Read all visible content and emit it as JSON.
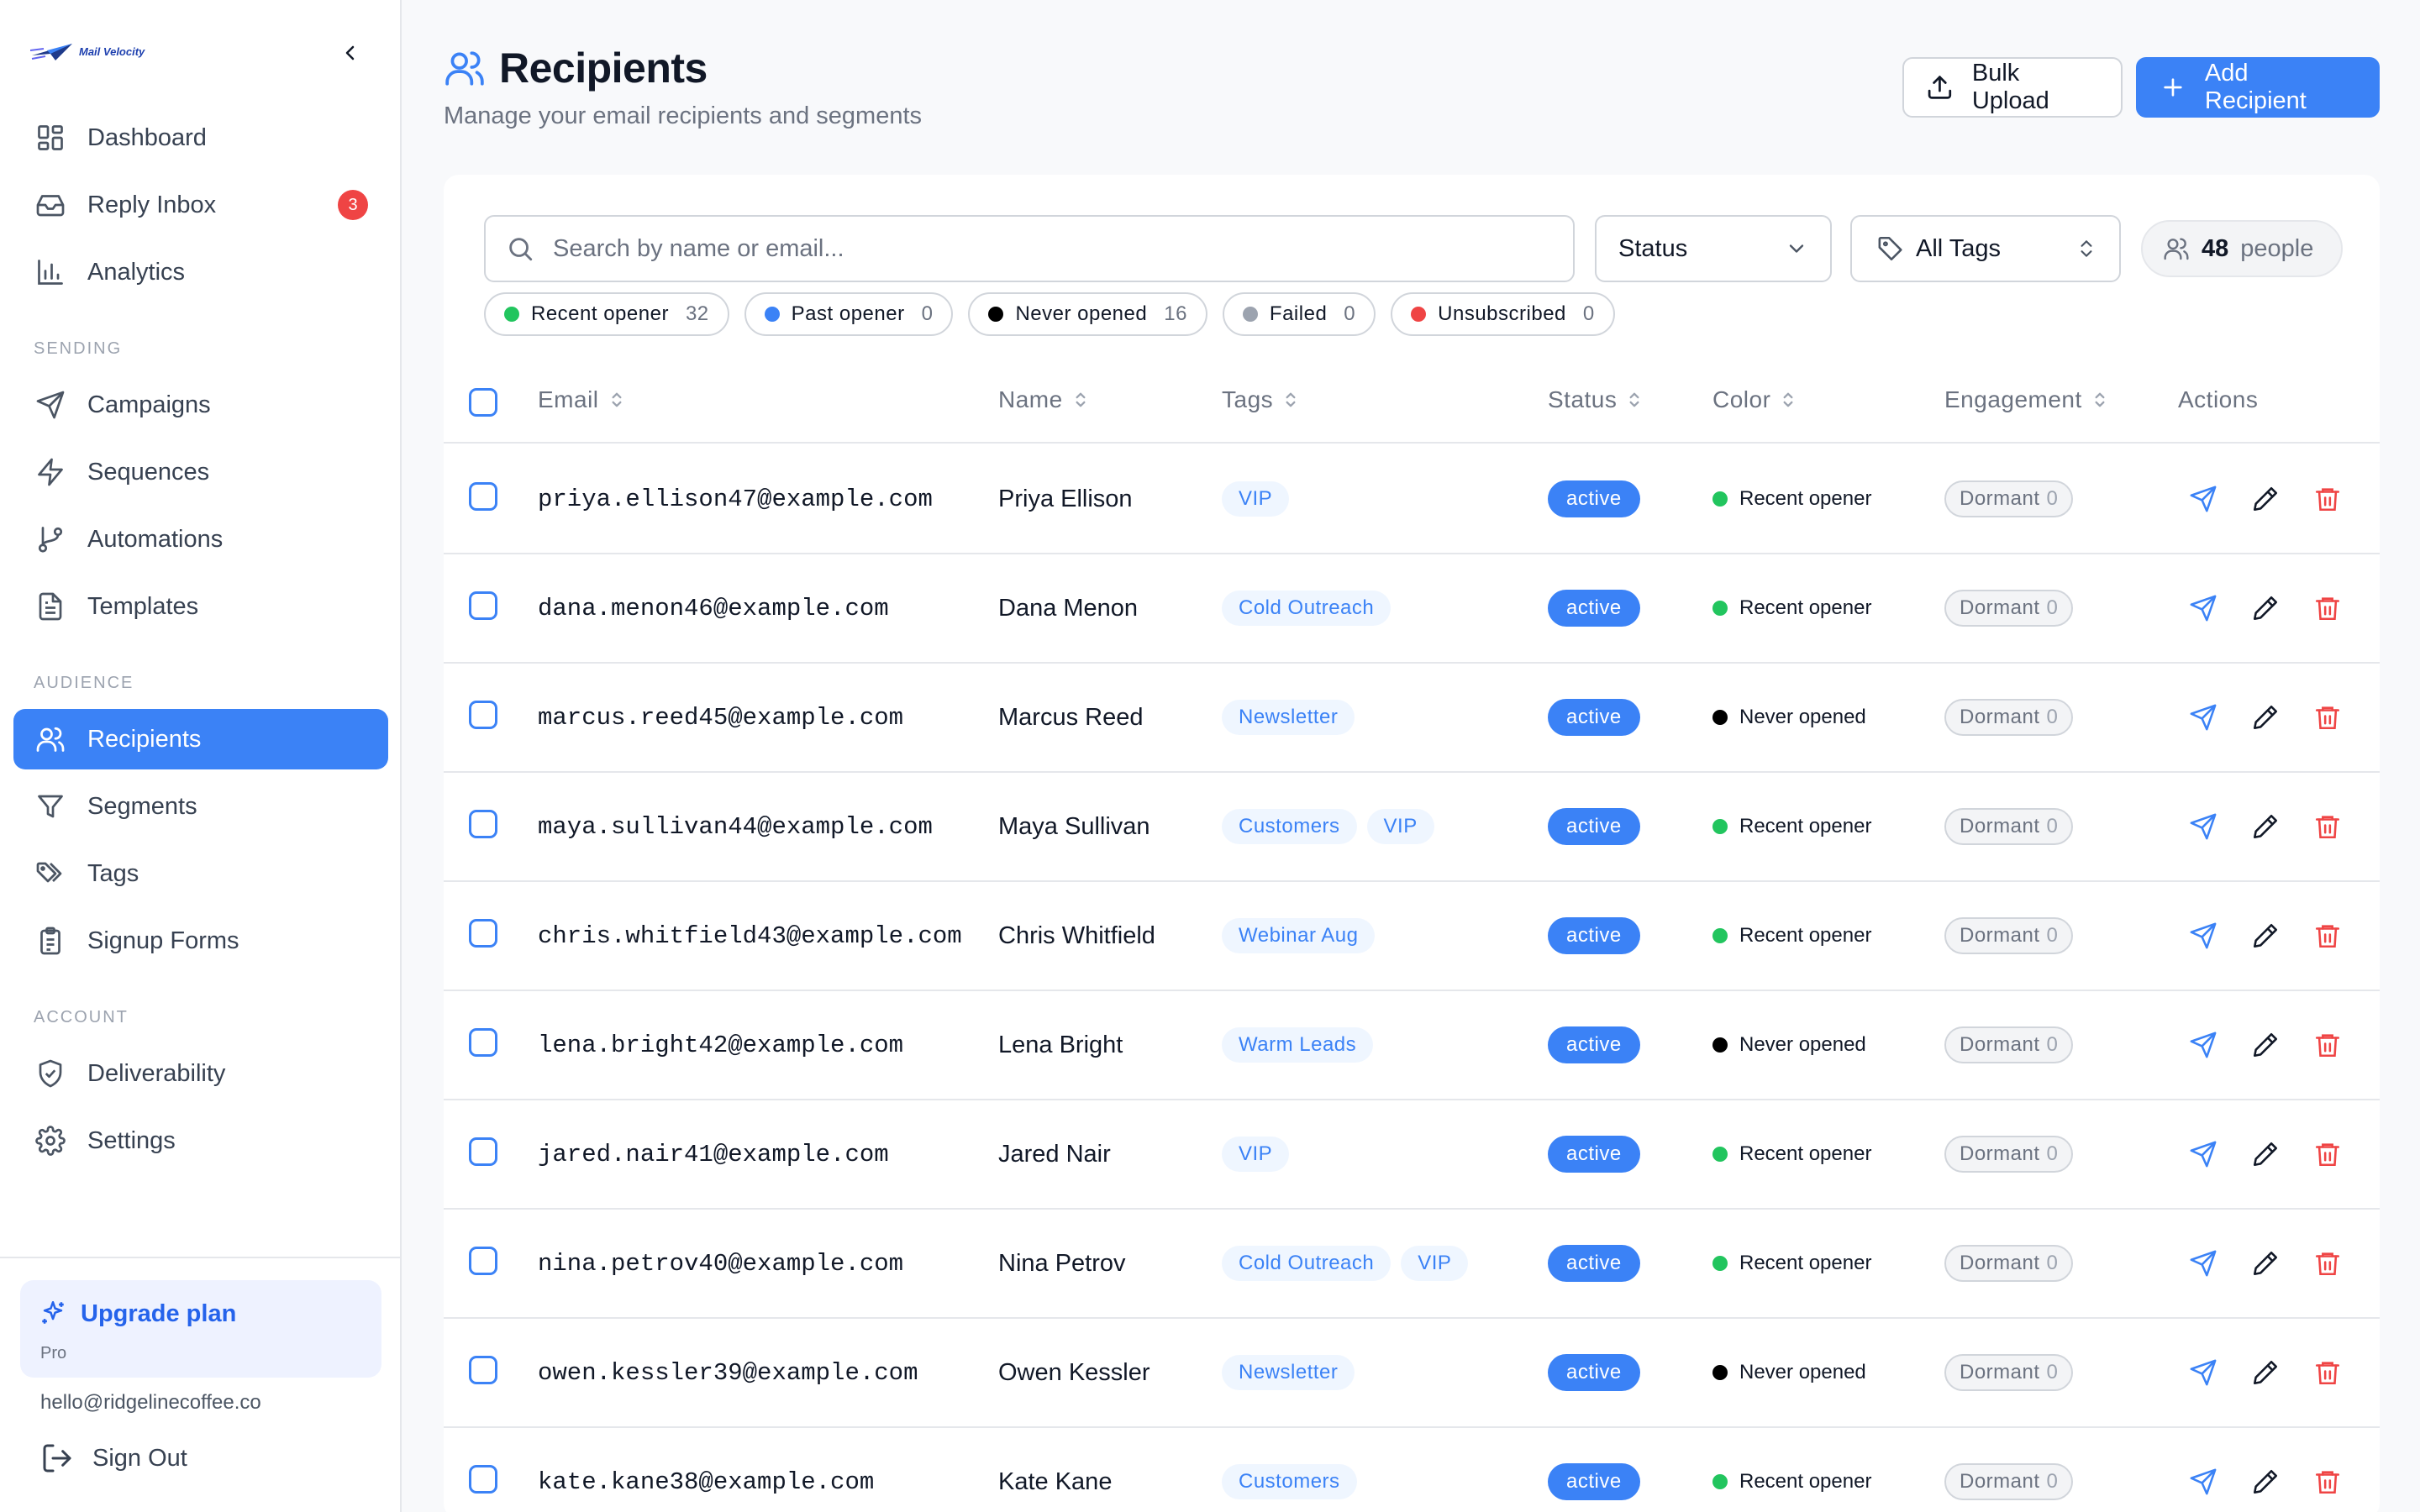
{
  "brand": {
    "name": "Mail Velocity",
    "accent": "#3b82f6"
  },
  "sidebar": {
    "nav": [
      {
        "label": "Dashboard",
        "icon": "dashboard-icon"
      },
      {
        "label": "Reply Inbox",
        "icon": "inbox-icon",
        "badge": "3"
      },
      {
        "label": "Analytics",
        "icon": "bar-chart-icon"
      }
    ],
    "sections": {
      "sending": "SENDING",
      "audience": "AUDIENCE",
      "account": "ACCOUNT"
    },
    "sending": [
      {
        "label": "Campaigns",
        "icon": "send-icon"
      },
      {
        "label": "Sequences",
        "icon": "lightning-icon"
      },
      {
        "label": "Automations",
        "icon": "git-branch-icon"
      },
      {
        "label": "Templates",
        "icon": "file-text-icon"
      }
    ],
    "audience": [
      {
        "label": "Recipients",
        "icon": "users-icon",
        "active": true
      },
      {
        "label": "Segments",
        "icon": "filter-icon"
      },
      {
        "label": "Tags",
        "icon": "tags-icon"
      },
      {
        "label": "Signup Forms",
        "icon": "clipboard-icon"
      }
    ],
    "account": [
      {
        "label": "Deliverability",
        "icon": "shield-check-icon"
      },
      {
        "label": "Settings",
        "icon": "gear-icon"
      }
    ],
    "upgrade": {
      "title": "Upgrade plan",
      "plan": "Pro"
    },
    "user_email": "hello@ridgelinecoffee.co",
    "sign_out": "Sign Out"
  },
  "header": {
    "title": "Recipients",
    "subtitle": "Manage your email recipients and segments",
    "bulk_upload": "Bulk Upload",
    "add_recipient": "Add Recipient"
  },
  "filters": {
    "search_placeholder": "Search by name or email...",
    "status_label": "Status",
    "tags_label": "All Tags",
    "people_count": "48",
    "people_label": "people",
    "chips": [
      {
        "label": "Recent opener",
        "count": "32",
        "color": "#22c55e"
      },
      {
        "label": "Past opener",
        "count": "0",
        "color": "#3b82f6"
      },
      {
        "label": "Never opened",
        "count": "16",
        "color": "#000000"
      },
      {
        "label": "Failed",
        "count": "0",
        "color": "#9ca3af"
      },
      {
        "label": "Unsubscribed",
        "count": "0",
        "color": "#ef4444"
      }
    ]
  },
  "table": {
    "columns": {
      "email": "Email",
      "name": "Name",
      "tags": "Tags",
      "status": "Status",
      "color": "Color",
      "engagement": "Engagement",
      "actions": "Actions"
    },
    "rows": [
      {
        "email": "priya.ellison47@example.com",
        "name": "Priya Ellison",
        "tags": [
          "VIP"
        ],
        "status": "active",
        "color_label": "Recent opener",
        "color": "#22c55e",
        "engagement": "Dormant",
        "engagement_count": "0"
      },
      {
        "email": "dana.menon46@example.com",
        "name": "Dana Menon",
        "tags": [
          "Cold Outreach"
        ],
        "status": "active",
        "color_label": "Recent opener",
        "color": "#22c55e",
        "engagement": "Dormant",
        "engagement_count": "0"
      },
      {
        "email": "marcus.reed45@example.com",
        "name": "Marcus Reed",
        "tags": [
          "Newsletter"
        ],
        "status": "active",
        "color_label": "Never opened",
        "color": "#000000",
        "engagement": "Dormant",
        "engagement_count": "0"
      },
      {
        "email": "maya.sullivan44@example.com",
        "name": "Maya Sullivan",
        "tags": [
          "Customers",
          "VIP"
        ],
        "status": "active",
        "color_label": "Recent opener",
        "color": "#22c55e",
        "engagement": "Dormant",
        "engagement_count": "0"
      },
      {
        "email": "chris.whitfield43@example.com",
        "name": "Chris Whitfield",
        "tags": [
          "Webinar Aug"
        ],
        "status": "active",
        "color_label": "Recent opener",
        "color": "#22c55e",
        "engagement": "Dormant",
        "engagement_count": "0"
      },
      {
        "email": "lena.bright42@example.com",
        "name": "Lena Bright",
        "tags": [
          "Warm Leads"
        ],
        "status": "active",
        "color_label": "Never opened",
        "color": "#000000",
        "engagement": "Dormant",
        "engagement_count": "0"
      },
      {
        "email": "jared.nair41@example.com",
        "name": "Jared Nair",
        "tags": [
          "VIP"
        ],
        "status": "active",
        "color_label": "Recent opener",
        "color": "#22c55e",
        "engagement": "Dormant",
        "engagement_count": "0"
      },
      {
        "email": "nina.petrov40@example.com",
        "name": "Nina Petrov",
        "tags": [
          "Cold Outreach",
          "VIP"
        ],
        "status": "active",
        "color_label": "Recent opener",
        "color": "#22c55e",
        "engagement": "Dormant",
        "engagement_count": "0"
      },
      {
        "email": "owen.kessler39@example.com",
        "name": "Owen Kessler",
        "tags": [
          "Newsletter"
        ],
        "status": "active",
        "color_label": "Never opened",
        "color": "#000000",
        "engagement": "Dormant",
        "engagement_count": "0"
      },
      {
        "email": "kate.kane38@example.com",
        "name": "Kate Kane",
        "tags": [
          "Customers"
        ],
        "status": "active",
        "color_label": "Recent opener",
        "color": "#22c55e",
        "engagement": "Dormant",
        "engagement_count": "0"
      }
    ]
  }
}
